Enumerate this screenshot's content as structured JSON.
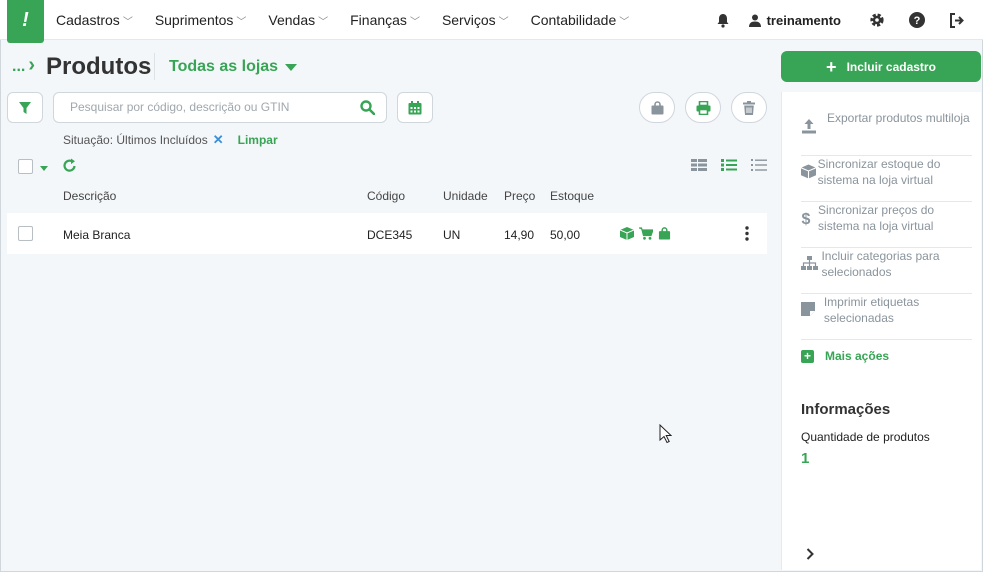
{
  "nav": {
    "logo": "!",
    "menu": [
      "Cadastros",
      "Suprimentos",
      "Vendas",
      "Finanças",
      "Serviços",
      "Contabilidade"
    ],
    "user": "treinamento"
  },
  "header": {
    "breadcrumb": "...",
    "title": "Produtos",
    "stores": "Todas as lojas"
  },
  "search": {
    "placeholder": "Pesquisar por código, descrição ou GTIN",
    "value": ""
  },
  "filter": {
    "label": "Situação: Últimos Incluídos",
    "remove": "✕",
    "clear": "Limpar"
  },
  "table": {
    "headers": [
      "Descrição",
      "Código",
      "Unidade",
      "Preço",
      "Estoque"
    ],
    "rows": [
      {
        "descricao": "Meia Branca",
        "codigo": "DCE345",
        "unidade": "UN",
        "preco": "14,90",
        "estoque": "50,00"
      }
    ]
  },
  "panel": {
    "add_button": "Incluir cadastro",
    "actions": [
      {
        "label": "Exportar produtos multiloja",
        "icon": "upload-icon"
      },
      {
        "label": "Sincronizar estoque do sistema na loja virtual",
        "icon": "box-icon"
      },
      {
        "label": "Sincronizar preços do sistema na loja virtual",
        "icon": "dollar-icon"
      },
      {
        "label": "Incluir categorias para selecionados",
        "icon": "sitemap-icon"
      },
      {
        "label": "Imprimir etiquetas selecionadas",
        "icon": "label-icon"
      }
    ],
    "more": "Mais ações",
    "info_title": "Informações",
    "info_label": "Quantidade de produtos",
    "info_value": "1"
  },
  "colors": {
    "brand": "#38a455",
    "link_blue": "#3a8fd9",
    "muted": "#8a949c"
  }
}
